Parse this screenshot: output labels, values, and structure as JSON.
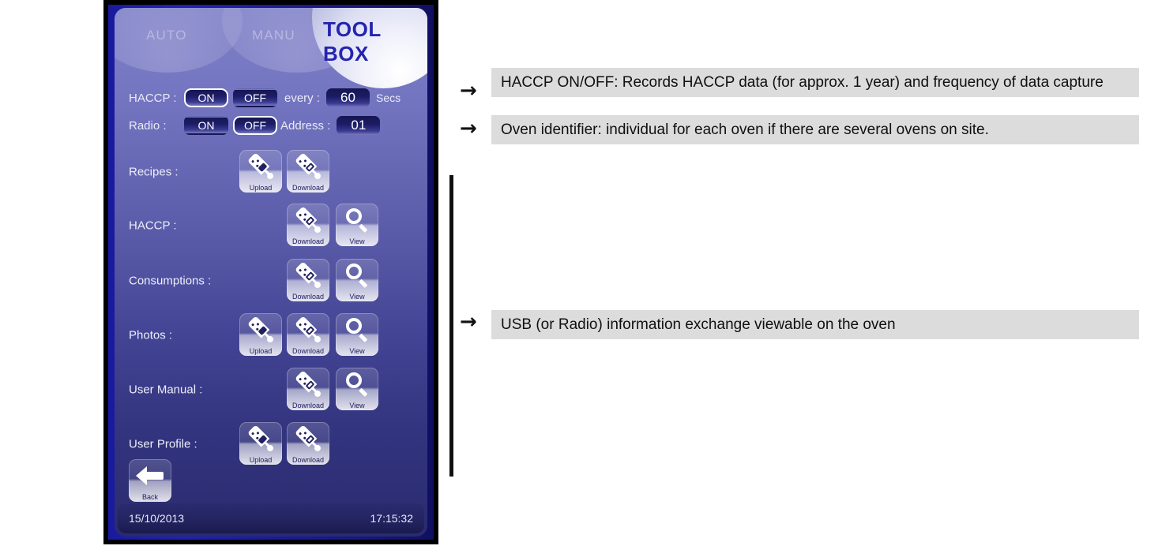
{
  "device": {
    "header": {
      "tabs": [
        {
          "id": "auto",
          "label": "AUTO",
          "selected": false
        },
        {
          "id": "manu",
          "label": "MANU",
          "selected": false
        },
        {
          "id": "toolbox",
          "label": "TOOL BOX",
          "selected": true
        }
      ]
    },
    "settings": {
      "haccp": {
        "label": "HACCP :",
        "on_label": "ON",
        "off_label": "OFF",
        "selected": "ON",
        "every_label": "every :",
        "interval_value": "60",
        "unit_label": "Secs"
      },
      "radio": {
        "label": "Radio :",
        "on_label": "ON",
        "off_label": "OFF",
        "selected": "OFF",
        "address_label": "Address :",
        "address_value": "01"
      }
    },
    "functions": [
      {
        "label": "Recipes :",
        "upload": "Upload",
        "download": "Download",
        "view": null
      },
      {
        "label": "HACCP :",
        "upload": null,
        "download": "Download",
        "view": "View"
      },
      {
        "label": "Consumptions :",
        "upload": null,
        "download": "Download",
        "view": "View"
      },
      {
        "label": "Photos :",
        "upload": "Upload",
        "download": "Download",
        "view": "View"
      },
      {
        "label": "User Manual :",
        "upload": null,
        "download": "Download",
        "view": "View"
      },
      {
        "label": "User Profile :",
        "upload": "Upload",
        "download": "Download",
        "view": null
      }
    ],
    "back_button": {
      "label": "Back",
      "icon": "left-arrow-icon"
    },
    "statusbar": {
      "date": "15/10/2013",
      "time": "17:15:32"
    }
  },
  "annotations": [
    {
      "arrow": "→",
      "text": "HACCP ON/OFF: Records HACCP data (for approx. 1 year) and frequency of data capture"
    },
    {
      "arrow": "→",
      "text": "Oven identifier: individual for each oven if there are several ovens on site."
    },
    {
      "arrow": "→",
      "text": "USB (or Radio) information exchange viewable on the oven"
    }
  ],
  "colors": {
    "panel_border": "#000000",
    "panel_bezel": "#1d1db0",
    "screen_top": "#7f80c8",
    "screen_bottom": "#2a2b6e",
    "title_blue": "#2424b0",
    "annotation_bg": "#dcdcdc",
    "annotation_text": "#101010",
    "bracket": "#111111"
  }
}
